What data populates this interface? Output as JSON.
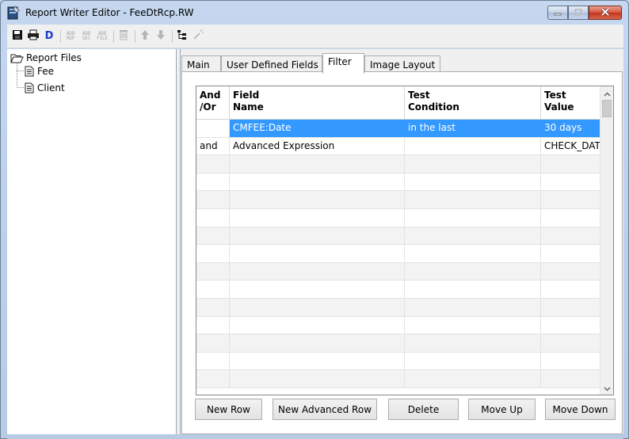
{
  "window": {
    "title": "Report Writer Editor - FeeDtRcp.RW"
  },
  "toolbar": {
    "items": [
      "save-icon",
      "print-icon",
      "design-icon",
      "add-rop-icon",
      "add-sec-icon",
      "add-file-icon",
      "delete-icon",
      "move-up-icon",
      "move-down-icon",
      "tree-icon",
      "wand-icon"
    ],
    "design_label": "D",
    "add_rop_label": "ADD ROP",
    "add_sec_label": "ADD SEC",
    "add_file_label": "ADD FILE"
  },
  "tree": {
    "root": "Report Files",
    "children": [
      "Fee",
      "Client"
    ]
  },
  "tabs": [
    "Main",
    "User Defined Fields",
    "Filter",
    "Image Layout"
  ],
  "active_tab": "Filter",
  "grid": {
    "columns": [
      "And\n/Or",
      "Field\nName",
      "Test\nCondition",
      "Test\nValue"
    ],
    "rows": [
      [
        "",
        "CMFEE:Date",
        "in the last",
        "30 days"
      ],
      [
        "and",
        "Advanced Expression",
        "",
        "CHECK_DAT"
      ]
    ],
    "selected_row": 0
  },
  "buttons": {
    "new_row": "New Row",
    "new_advanced_row": "New Advanced Row",
    "delete": "Delete",
    "move_up": "Move Up",
    "move_down": "Move Down"
  },
  "colors": {
    "selection": "#3399ff",
    "close_button": "#c9412b"
  }
}
